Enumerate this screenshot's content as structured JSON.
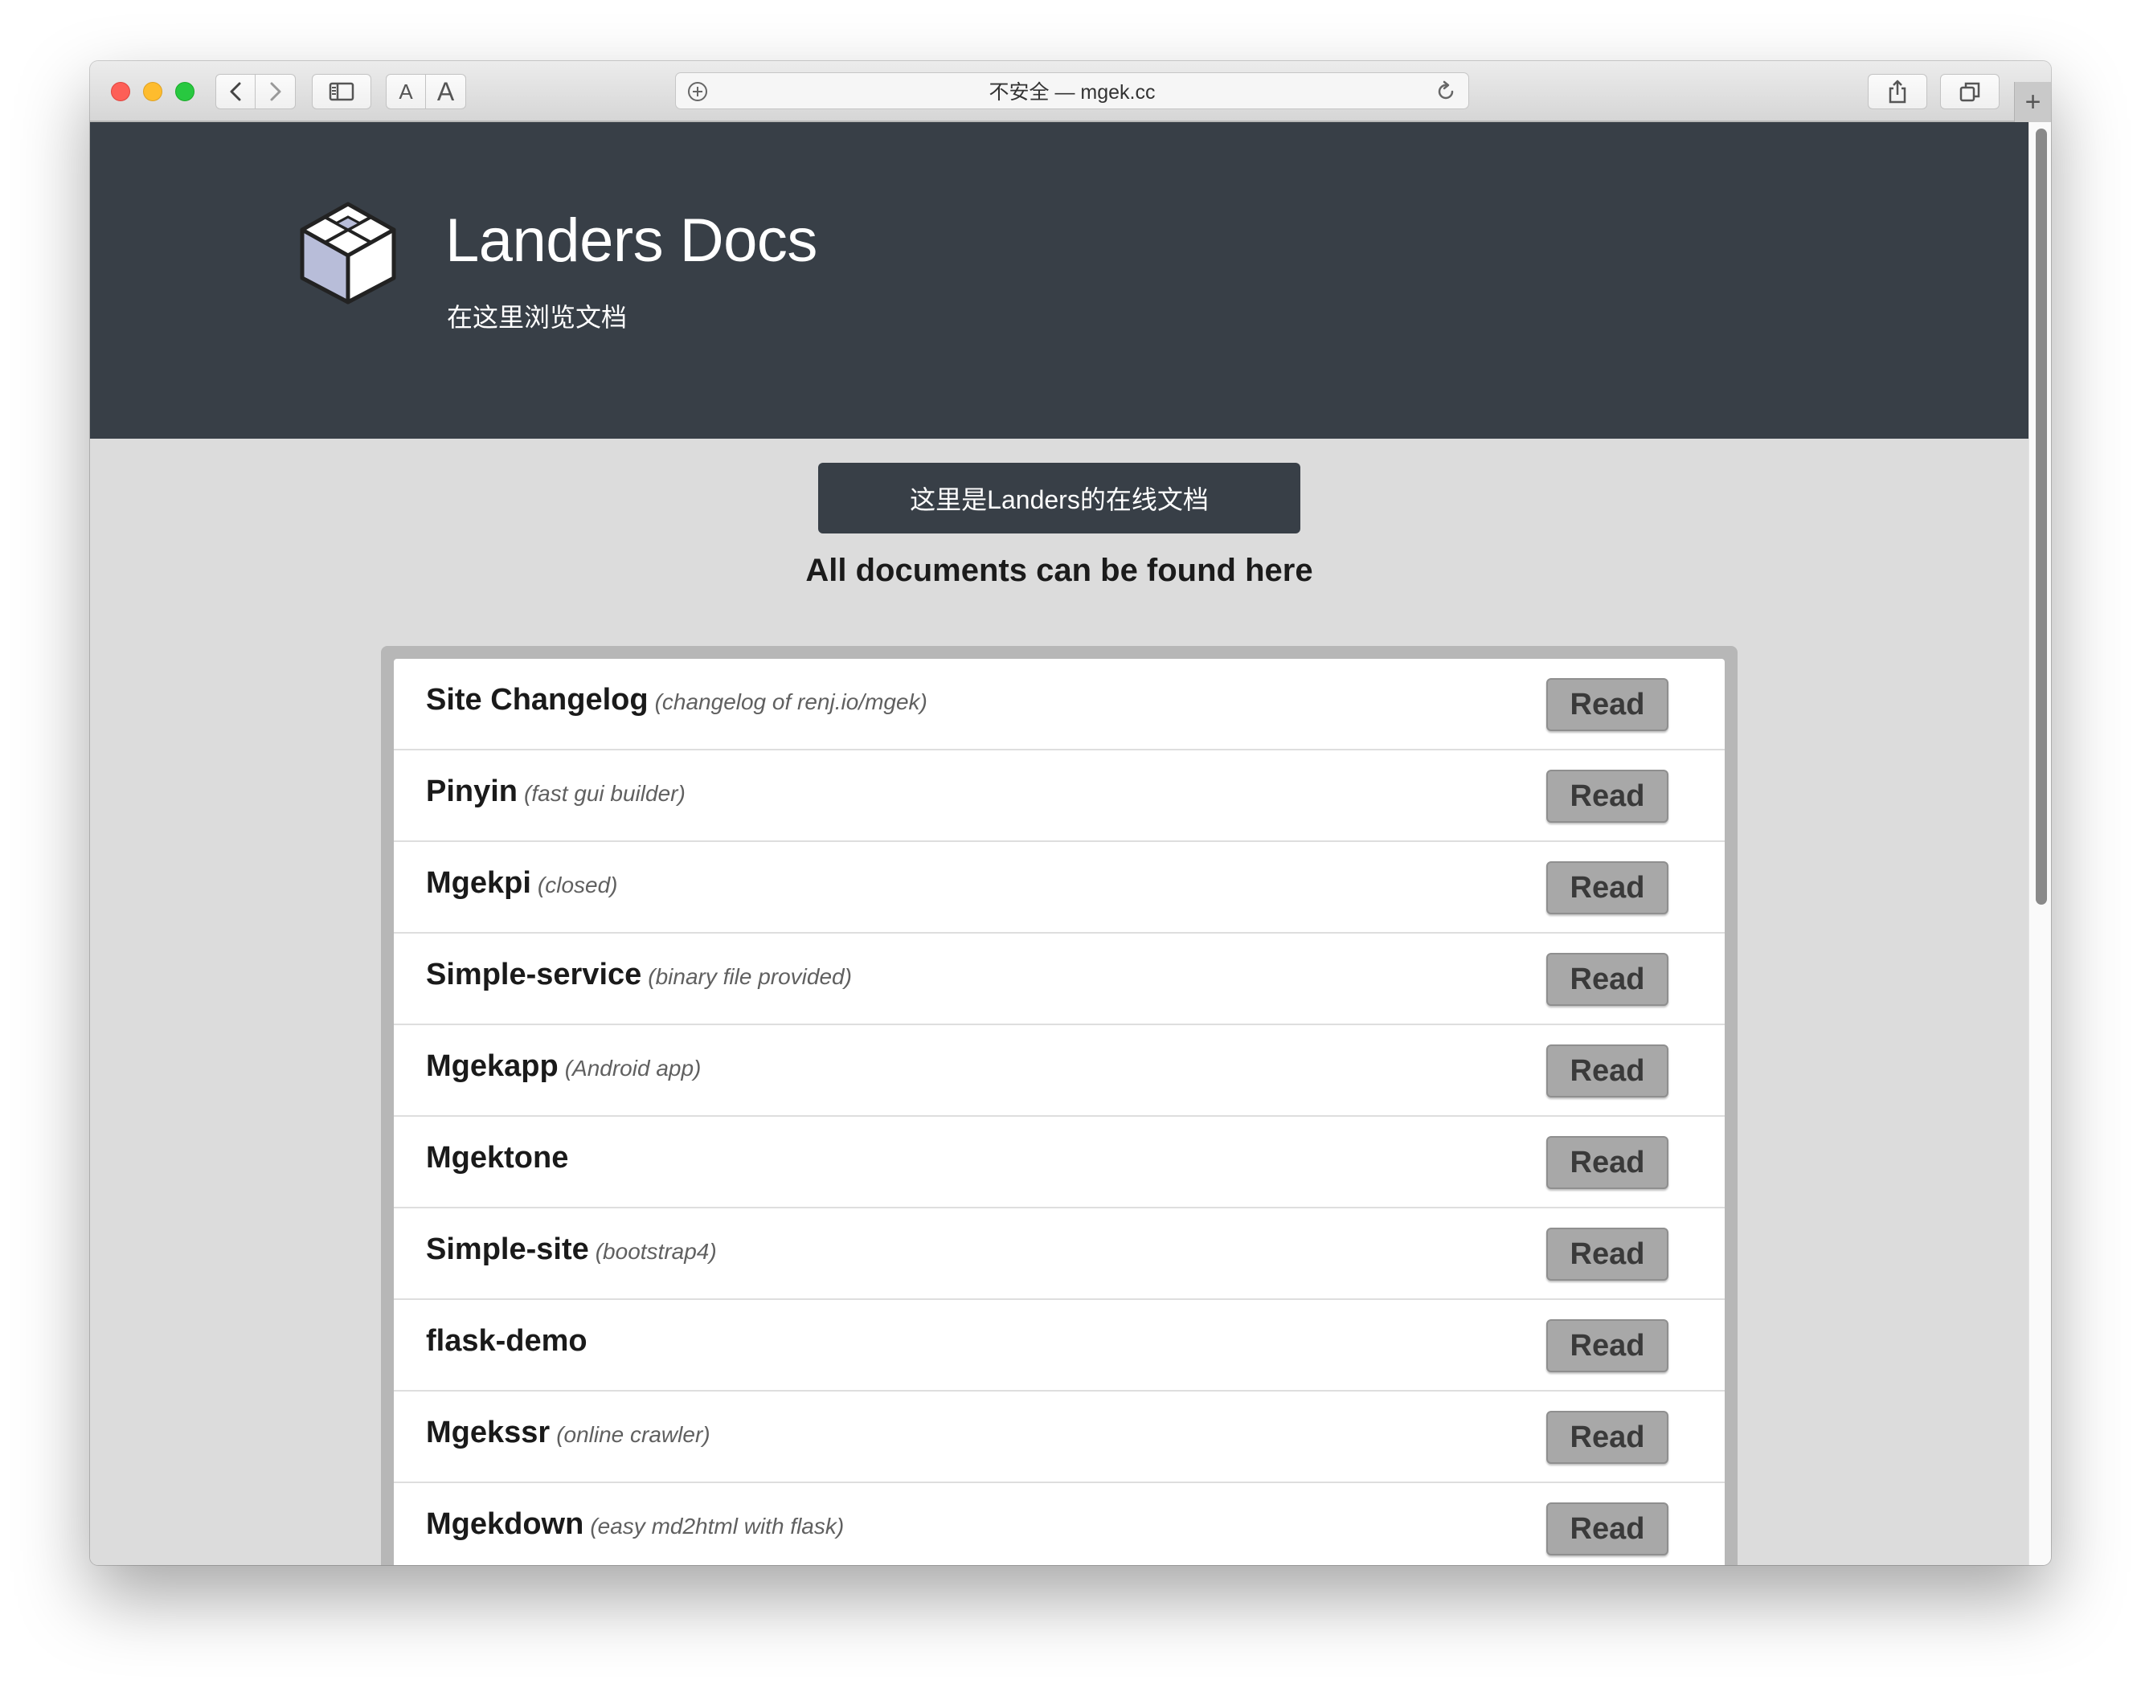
{
  "browser": {
    "address": "不安全 — mgek.cc",
    "font_small_label": "A",
    "font_large_label": "A",
    "new_tab_label": "+"
  },
  "hero": {
    "title": "Landers Docs",
    "subtitle": "在这里浏览文档"
  },
  "banner": "这里是Landers的在线文档",
  "tagline": "All documents can be found here",
  "read_label": "Read",
  "docs": [
    {
      "name": "Site Changelog",
      "desc": "(changelog of renj.io/mgek)"
    },
    {
      "name": "Pinyin",
      "desc": "(fast gui builder)"
    },
    {
      "name": "Mgekpi",
      "desc": "(closed)"
    },
    {
      "name": "Simple-service",
      "desc": "(binary file provided)"
    },
    {
      "name": "Mgekapp",
      "desc": "(Android app)"
    },
    {
      "name": "Mgektone",
      "desc": ""
    },
    {
      "name": "Simple-site",
      "desc": "(bootstrap4)"
    },
    {
      "name": "flask-demo",
      "desc": ""
    },
    {
      "name": "Mgekssr",
      "desc": "(online crawler)"
    },
    {
      "name": "Mgekdown",
      "desc": "(easy md2html with flask)"
    }
  ],
  "colors": {
    "hero_bg": "#383f47",
    "content_bg": "#dcdcdc",
    "read_button": "#a8a8a8"
  }
}
